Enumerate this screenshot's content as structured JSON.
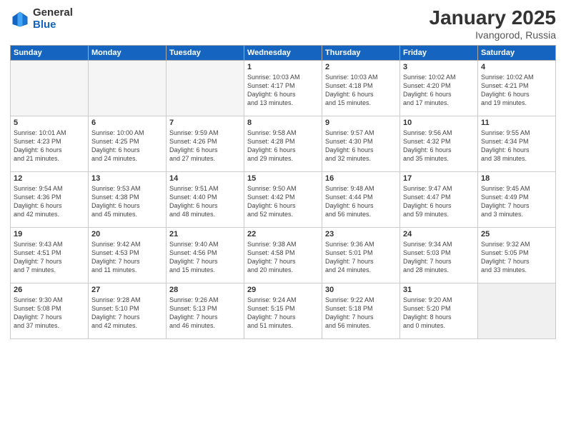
{
  "logo": {
    "general": "General",
    "blue": "Blue"
  },
  "title": "January 2025",
  "subtitle": "Ivangorod, Russia",
  "weekdays": [
    "Sunday",
    "Monday",
    "Tuesday",
    "Wednesday",
    "Thursday",
    "Friday",
    "Saturday"
  ],
  "weeks": [
    [
      {
        "day": "",
        "info": "",
        "empty": true
      },
      {
        "day": "",
        "info": "",
        "empty": true
      },
      {
        "day": "",
        "info": "",
        "empty": true
      },
      {
        "day": "1",
        "info": "Sunrise: 10:03 AM\nSunset: 4:17 PM\nDaylight: 6 hours\nand 13 minutes."
      },
      {
        "day": "2",
        "info": "Sunrise: 10:03 AM\nSunset: 4:18 PM\nDaylight: 6 hours\nand 15 minutes."
      },
      {
        "day": "3",
        "info": "Sunrise: 10:02 AM\nSunset: 4:20 PM\nDaylight: 6 hours\nand 17 minutes."
      },
      {
        "day": "4",
        "info": "Sunrise: 10:02 AM\nSunset: 4:21 PM\nDaylight: 6 hours\nand 19 minutes."
      }
    ],
    [
      {
        "day": "5",
        "info": "Sunrise: 10:01 AM\nSunset: 4:23 PM\nDaylight: 6 hours\nand 21 minutes."
      },
      {
        "day": "6",
        "info": "Sunrise: 10:00 AM\nSunset: 4:25 PM\nDaylight: 6 hours\nand 24 minutes."
      },
      {
        "day": "7",
        "info": "Sunrise: 9:59 AM\nSunset: 4:26 PM\nDaylight: 6 hours\nand 27 minutes."
      },
      {
        "day": "8",
        "info": "Sunrise: 9:58 AM\nSunset: 4:28 PM\nDaylight: 6 hours\nand 29 minutes."
      },
      {
        "day": "9",
        "info": "Sunrise: 9:57 AM\nSunset: 4:30 PM\nDaylight: 6 hours\nand 32 minutes."
      },
      {
        "day": "10",
        "info": "Sunrise: 9:56 AM\nSunset: 4:32 PM\nDaylight: 6 hours\nand 35 minutes."
      },
      {
        "day": "11",
        "info": "Sunrise: 9:55 AM\nSunset: 4:34 PM\nDaylight: 6 hours\nand 38 minutes."
      }
    ],
    [
      {
        "day": "12",
        "info": "Sunrise: 9:54 AM\nSunset: 4:36 PM\nDaylight: 6 hours\nand 42 minutes."
      },
      {
        "day": "13",
        "info": "Sunrise: 9:53 AM\nSunset: 4:38 PM\nDaylight: 6 hours\nand 45 minutes."
      },
      {
        "day": "14",
        "info": "Sunrise: 9:51 AM\nSunset: 4:40 PM\nDaylight: 6 hours\nand 48 minutes."
      },
      {
        "day": "15",
        "info": "Sunrise: 9:50 AM\nSunset: 4:42 PM\nDaylight: 6 hours\nand 52 minutes."
      },
      {
        "day": "16",
        "info": "Sunrise: 9:48 AM\nSunset: 4:44 PM\nDaylight: 6 hours\nand 56 minutes."
      },
      {
        "day": "17",
        "info": "Sunrise: 9:47 AM\nSunset: 4:47 PM\nDaylight: 6 hours\nand 59 minutes."
      },
      {
        "day": "18",
        "info": "Sunrise: 9:45 AM\nSunset: 4:49 PM\nDaylight: 7 hours\nand 3 minutes."
      }
    ],
    [
      {
        "day": "19",
        "info": "Sunrise: 9:43 AM\nSunset: 4:51 PM\nDaylight: 7 hours\nand 7 minutes."
      },
      {
        "day": "20",
        "info": "Sunrise: 9:42 AM\nSunset: 4:53 PM\nDaylight: 7 hours\nand 11 minutes."
      },
      {
        "day": "21",
        "info": "Sunrise: 9:40 AM\nSunset: 4:56 PM\nDaylight: 7 hours\nand 15 minutes."
      },
      {
        "day": "22",
        "info": "Sunrise: 9:38 AM\nSunset: 4:58 PM\nDaylight: 7 hours\nand 20 minutes."
      },
      {
        "day": "23",
        "info": "Sunrise: 9:36 AM\nSunset: 5:01 PM\nDaylight: 7 hours\nand 24 minutes."
      },
      {
        "day": "24",
        "info": "Sunrise: 9:34 AM\nSunset: 5:03 PM\nDaylight: 7 hours\nand 28 minutes."
      },
      {
        "day": "25",
        "info": "Sunrise: 9:32 AM\nSunset: 5:05 PM\nDaylight: 7 hours\nand 33 minutes."
      }
    ],
    [
      {
        "day": "26",
        "info": "Sunrise: 9:30 AM\nSunset: 5:08 PM\nDaylight: 7 hours\nand 37 minutes."
      },
      {
        "day": "27",
        "info": "Sunrise: 9:28 AM\nSunset: 5:10 PM\nDaylight: 7 hours\nand 42 minutes."
      },
      {
        "day": "28",
        "info": "Sunrise: 9:26 AM\nSunset: 5:13 PM\nDaylight: 7 hours\nand 46 minutes."
      },
      {
        "day": "29",
        "info": "Sunrise: 9:24 AM\nSunset: 5:15 PM\nDaylight: 7 hours\nand 51 minutes."
      },
      {
        "day": "30",
        "info": "Sunrise: 9:22 AM\nSunset: 5:18 PM\nDaylight: 7 hours\nand 56 minutes."
      },
      {
        "day": "31",
        "info": "Sunrise: 9:20 AM\nSunset: 5:20 PM\nDaylight: 8 hours\nand 0 minutes."
      },
      {
        "day": "",
        "info": "",
        "empty": true,
        "shaded": true
      }
    ]
  ]
}
